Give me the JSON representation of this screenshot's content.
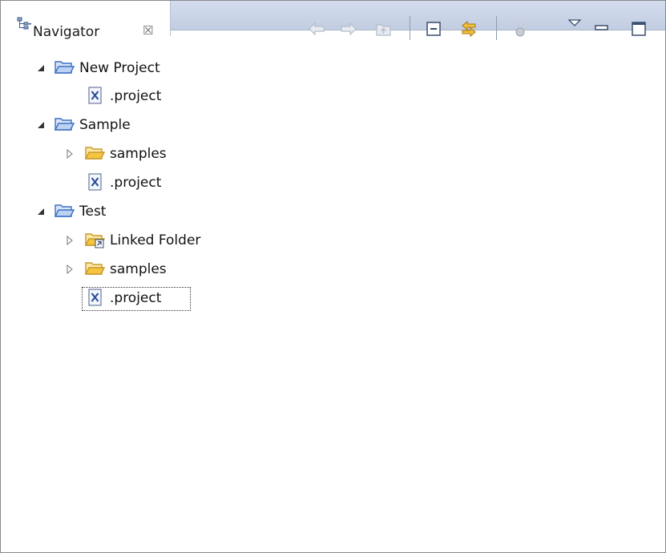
{
  "view": {
    "title": "Navigator",
    "close_symbol": "☒",
    "icon": "navigator-icon"
  },
  "toolbar": {
    "buttons": [
      {
        "name": "back-button",
        "icon": "arrow-left-icon"
      },
      {
        "name": "forward-button",
        "icon": "arrow-right-icon"
      },
      {
        "name": "up-button",
        "icon": "folder-up-icon"
      },
      {
        "name": "collapse-all-button",
        "icon": "collapse-all-icon"
      },
      {
        "name": "link-with-editor-button",
        "icon": "link-with-editor-icon"
      },
      {
        "name": "filters-button",
        "icon": "filters-icon"
      },
      {
        "name": "view-menu-button",
        "icon": "triangle-down-icon"
      },
      {
        "name": "minimize-button",
        "icon": "minimize-icon"
      },
      {
        "name": "maximize-button",
        "icon": "maximize-icon"
      }
    ]
  },
  "tree": {
    "nodes": [
      {
        "label": "New Project",
        "type": "project",
        "expanded": true
      },
      {
        "label": ".project",
        "type": "xml-file"
      },
      {
        "label": "Sample",
        "type": "project",
        "expanded": true
      },
      {
        "label": "samples",
        "type": "folder",
        "expanded": false
      },
      {
        "label": ".project",
        "type": "xml-file"
      },
      {
        "label": "Test",
        "type": "project",
        "expanded": true
      },
      {
        "label": "Linked Folder",
        "type": "linked-folder",
        "expanded": false
      },
      {
        "label": "samples",
        "type": "folder",
        "expanded": false
      },
      {
        "label": ".project",
        "type": "xml-file",
        "selected": true
      }
    ]
  },
  "colors": {
    "tab_bar": "#c9d4e8",
    "folder_yellow": "#f5c542",
    "project_blue": "#4a7fd6",
    "xml_file_blue": "#2c4f9e"
  }
}
